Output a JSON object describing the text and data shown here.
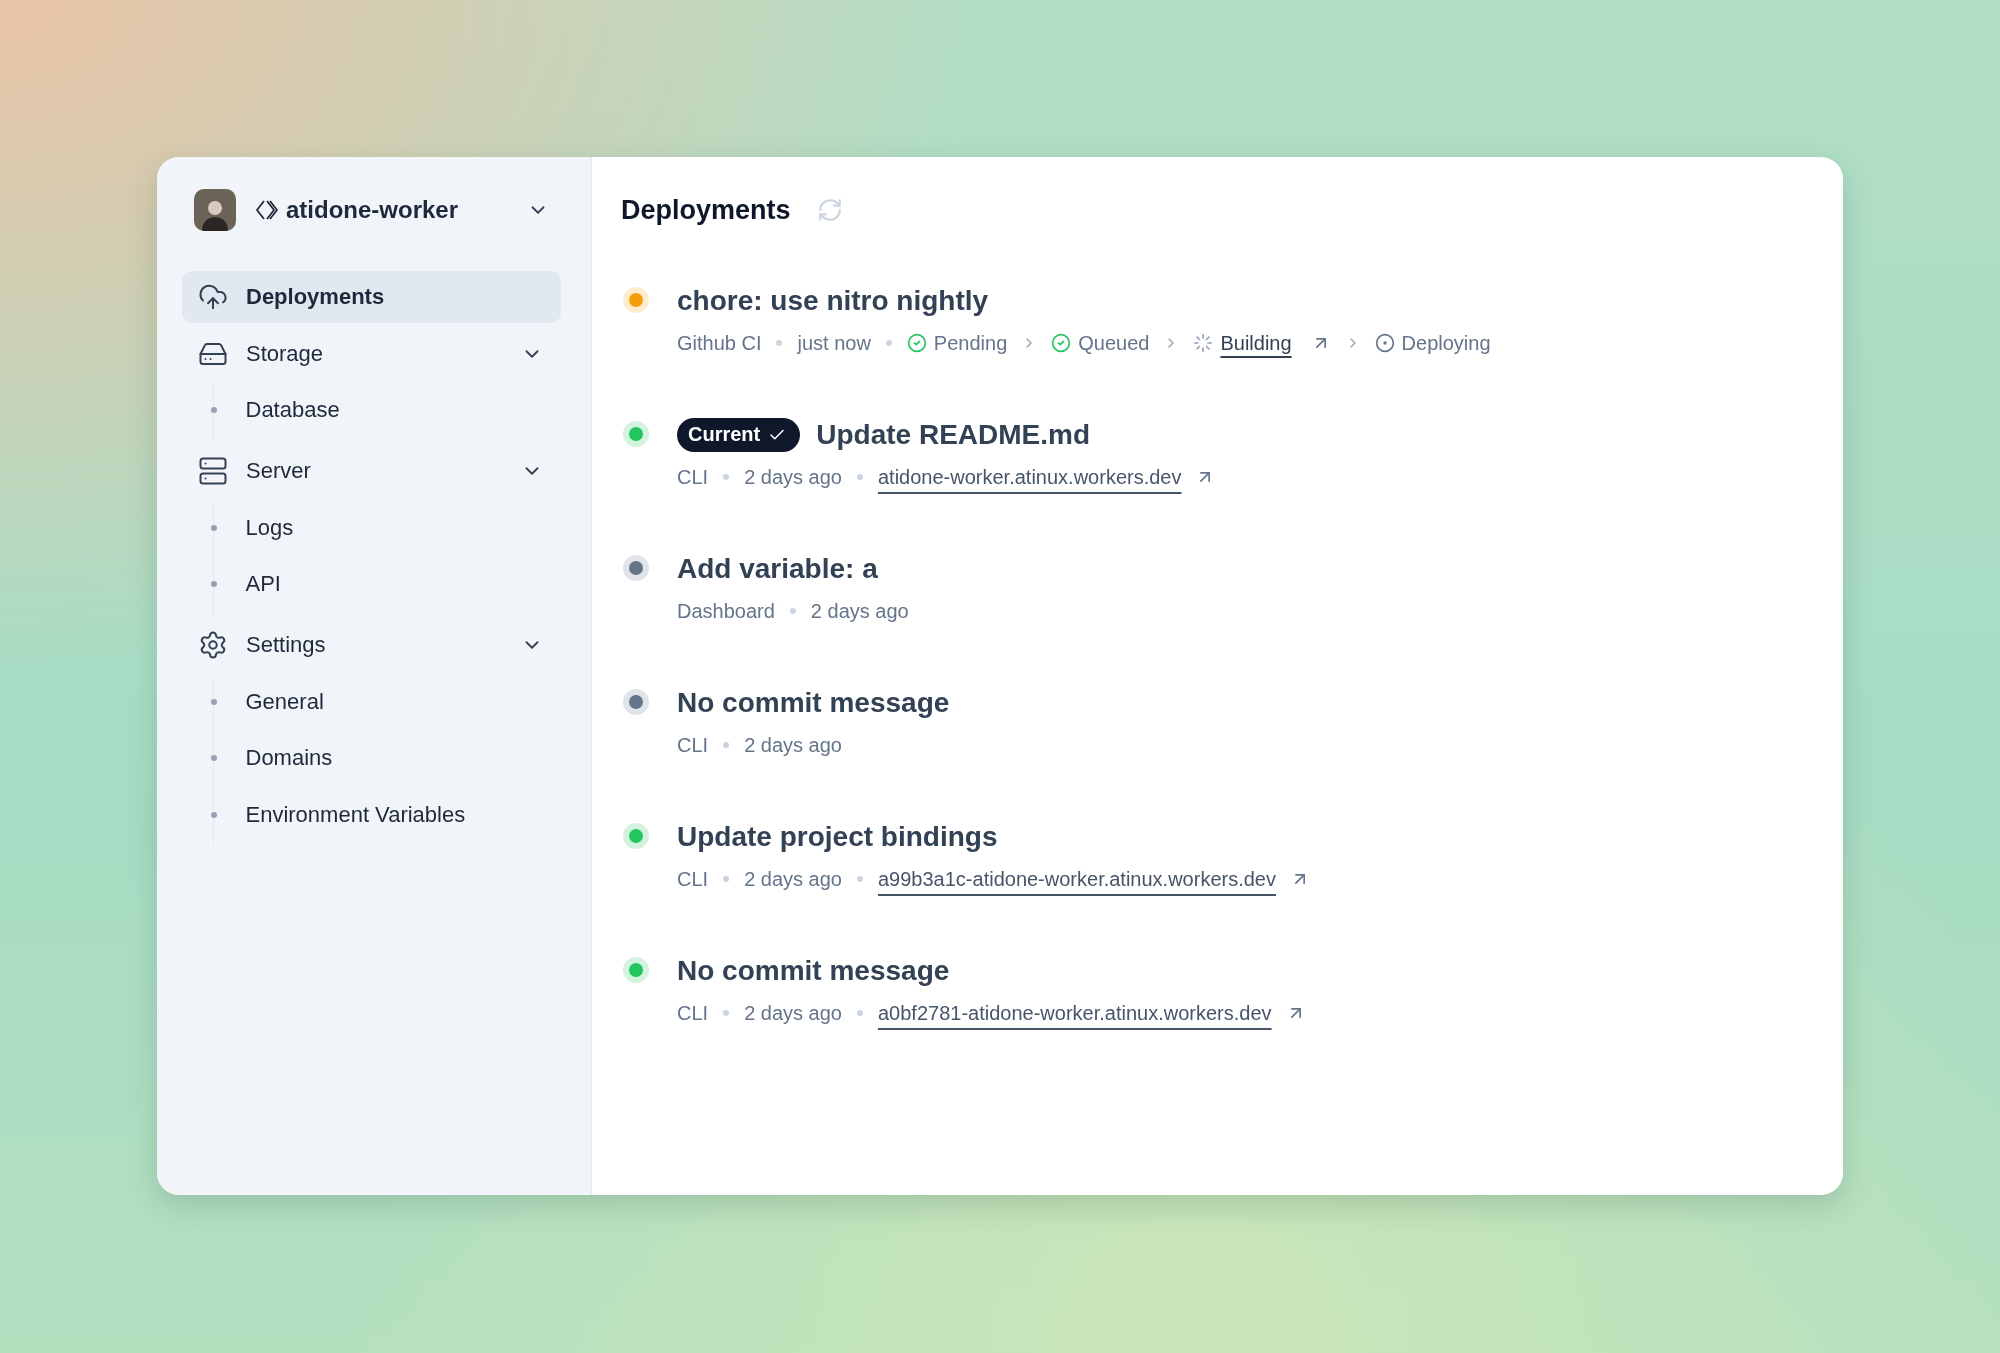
{
  "project": {
    "name": "atidone-worker"
  },
  "nav": [
    {
      "label": "Deployments",
      "selected": true
    },
    {
      "label": "Storage",
      "selected": false,
      "expanded": true,
      "children": [
        {
          "label": "Database",
          "selected": false
        }
      ]
    },
    {
      "label": "Server",
      "selected": false,
      "expanded": true,
      "children": [
        {
          "label": "Logs",
          "selected": false
        },
        {
          "label": "API",
          "selected": false
        }
      ]
    },
    {
      "label": "Settings",
      "selected": false,
      "expanded": true,
      "children": [
        {
          "label": "General",
          "selected": false
        },
        {
          "label": "Domains",
          "selected": false
        },
        {
          "label": "Environment Variables",
          "selected": false
        }
      ]
    }
  ],
  "main": {
    "title": "Deployments"
  },
  "deployments": [
    {
      "color": "#f59e0b",
      "title": "chore: use nitro nightly",
      "source": "Github CI",
      "time": "just now",
      "steps": [
        {
          "label": "Pending",
          "kind": "done",
          "linked": false
        },
        {
          "label": "Queued",
          "kind": "done",
          "linked": false
        },
        {
          "label": "Building",
          "kind": "building",
          "linked": true
        },
        {
          "label": "Deploying",
          "kind": "waiting",
          "linked": false
        }
      ]
    },
    {
      "color": "#22c55e",
      "badge": "Current",
      "title": "Update README.md",
      "source": "CLI",
      "time": "2 days ago",
      "url": "atidone-worker.atinux.workers.dev"
    },
    {
      "color": "#64748b",
      "title": "Add variable: a",
      "source": "Dashboard",
      "time": "2 days ago"
    },
    {
      "color": "#64748b",
      "title": "No commit message",
      "source": "CLI",
      "time": "2 days ago"
    },
    {
      "color": "#22c55e",
      "title": "Update project bindings",
      "source": "CLI",
      "time": "2 days ago",
      "url": "a99b3a1c-atidone-worker.atinux.workers.dev"
    },
    {
      "color": "#22c55e",
      "title": "No commit message",
      "source": "CLI",
      "time": "2 days ago",
      "url": "a0bf2781-atidone-worker.atinux.workers.dev"
    }
  ]
}
